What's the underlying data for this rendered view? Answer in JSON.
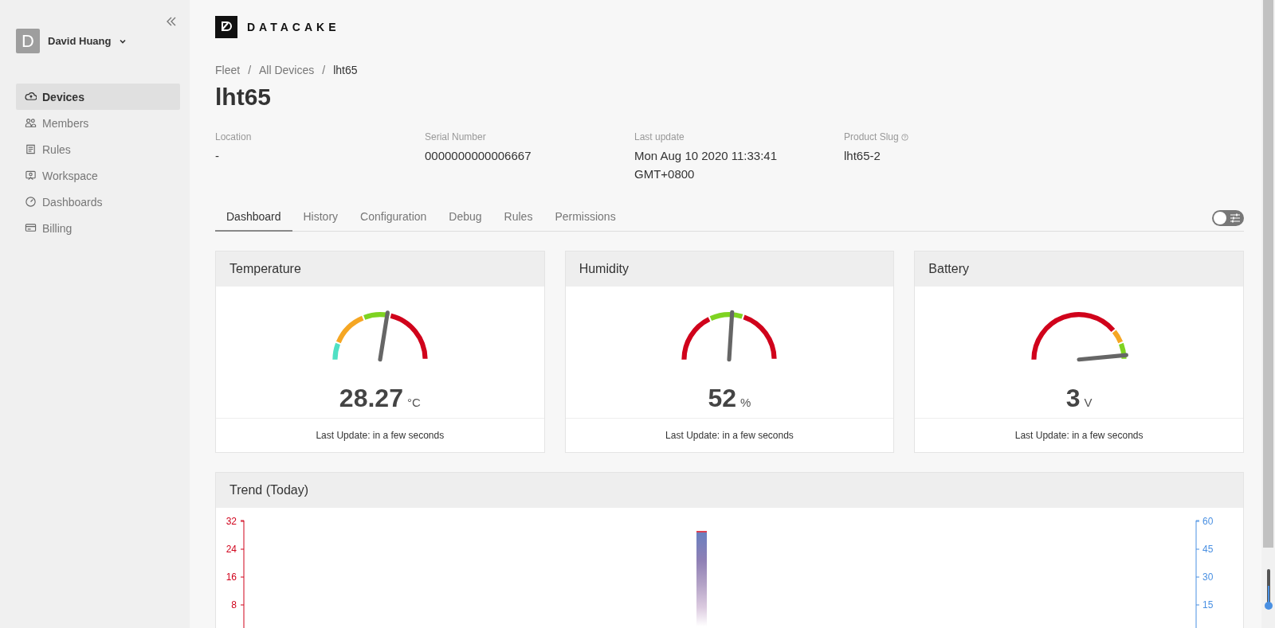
{
  "sidebar": {
    "user": {
      "initial": "D",
      "name": "David Huang"
    },
    "items": [
      {
        "label": "Devices",
        "selected": true
      },
      {
        "label": "Members",
        "selected": false
      },
      {
        "label": "Rules",
        "selected": false
      },
      {
        "label": "Workspace",
        "selected": false
      },
      {
        "label": "Dashboards",
        "selected": false
      },
      {
        "label": "Billing",
        "selected": false
      }
    ]
  },
  "brand": "DATACAKE",
  "breadcrumb": [
    {
      "kind": "link",
      "text": "Fleet"
    },
    {
      "kind": "separator",
      "text": "/"
    },
    {
      "kind": "link",
      "text": "All Devices"
    },
    {
      "kind": "separator",
      "text": "/"
    },
    {
      "kind": "current",
      "text": "lht65"
    }
  ],
  "title": "lht65",
  "info": [
    {
      "label": "Location",
      "value": "-"
    },
    {
      "label": "Serial Number",
      "value": "0000000000006667"
    },
    {
      "label": "Last update",
      "value": "Mon Aug 10 2020 11:33:41 GMT+0800"
    },
    {
      "label": "Product Slug",
      "value": "lht65-2",
      "help": true
    }
  ],
  "tabs": [
    {
      "label": "Dashboard",
      "selected": true
    },
    {
      "label": "History",
      "selected": false
    },
    {
      "label": "Configuration",
      "selected": false
    },
    {
      "label": "Debug",
      "selected": false
    },
    {
      "label": "Rules",
      "selected": false
    },
    {
      "label": "Permissions",
      "selected": false
    }
  ],
  "edit_toggle": {
    "on": false
  },
  "widgets": [
    {
      "title": "Temperature",
      "value": "28.27",
      "unit": "°C",
      "level": 0.55,
      "footer": "Last Update: in a few seconds",
      "segments": [
        {
          "color": "#4fe0c4"
        },
        {
          "color": "#f5a623"
        },
        {
          "color": "#7ed321"
        },
        {
          "color": "#d0021b"
        }
      ]
    },
    {
      "title": "Humidity",
      "value": "52",
      "unit": "%",
      "level": 0.52,
      "footer": "Last Update: in a few seconds",
      "segments": [
        {
          "color": "#d0021b"
        },
        {
          "color": "#7ed321"
        },
        {
          "color": "#d0021b"
        }
      ]
    },
    {
      "title": "Battery",
      "value": "3",
      "unit": "V",
      "level": 0.97,
      "footer": "Last Update: in a few seconds",
      "segments": [
        {
          "color": "#d0021b"
        },
        {
          "color": "#f5a623"
        },
        {
          "color": "#7ed321"
        }
      ]
    }
  ],
  "trend": {
    "title": "Trend (Today)",
    "left_ticks": [
      "32",
      "24",
      "16",
      "8"
    ],
    "right_ticks": [
      "60",
      "45",
      "30",
      "15"
    ]
  }
}
